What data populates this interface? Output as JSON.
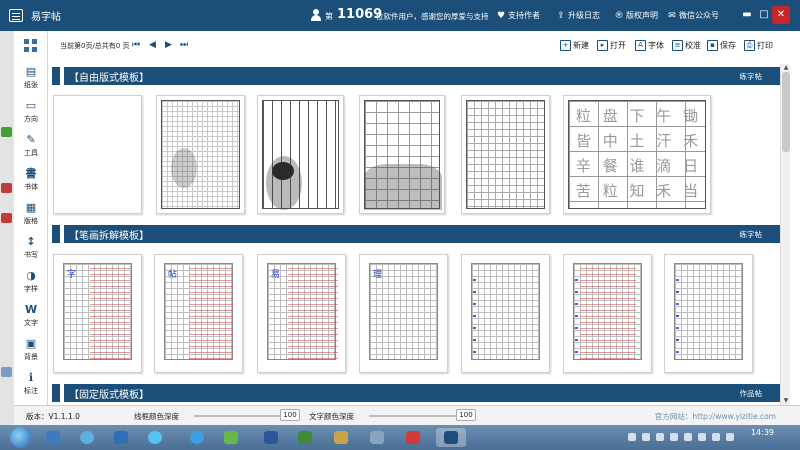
{
  "window": {
    "title": "易字帖",
    "user_prefix": "第",
    "user_count": "11069",
    "user_suffix": "位软件用户，感谢您的厚爱与支持",
    "links": [
      {
        "label": "支持作者",
        "icon": "heart-icon"
      },
      {
        "label": "升级日志",
        "icon": "upload-icon"
      },
      {
        "label": "版权声明",
        "icon": "copyright-icon"
      },
      {
        "label": "微信公众号",
        "icon": "wechat-icon"
      }
    ],
    "controls": {
      "minimize": "▬",
      "maximize": "□",
      "close": "✕"
    }
  },
  "sidebar": {
    "items": [
      {
        "label": "纸张",
        "glyph": "▤"
      },
      {
        "label": "方向",
        "glyph": "▭"
      },
      {
        "label": "工具",
        "glyph": "✎"
      },
      {
        "label": "书体",
        "glyph": "書"
      },
      {
        "label": "版格",
        "glyph": "▦"
      },
      {
        "label": "书写",
        "glyph": "↕"
      },
      {
        "label": "字样",
        "glyph": "◑"
      },
      {
        "label": "文字",
        "glyph": "W"
      },
      {
        "label": "背景",
        "glyph": "▣"
      },
      {
        "label": "标注",
        "glyph": "ℹ"
      }
    ]
  },
  "toolbar": {
    "page_info": "当前第0页/总共有0 页",
    "pager": {
      "first": "⏮",
      "prev": "◀",
      "next": "▶",
      "last": "⏭"
    },
    "actions": [
      {
        "label": "新建",
        "icon": "new-file-icon",
        "glyph": "+"
      },
      {
        "label": "打开",
        "icon": "folder-open-icon",
        "glyph": "▸"
      },
      {
        "label": "字体",
        "icon": "font-icon",
        "glyph": "A"
      },
      {
        "label": "校准",
        "icon": "calibrate-icon",
        "glyph": "≡"
      },
      {
        "label": "保存",
        "icon": "save-icon",
        "glyph": "▪"
      },
      {
        "label": "打印",
        "icon": "print-icon",
        "glyph": "⎙"
      }
    ]
  },
  "sections": [
    {
      "title": "【自由版式模板】",
      "link": "练字帖"
    },
    {
      "title": "【笔画拆解模板】",
      "link": "练字帖"
    },
    {
      "title": "【固定版式模板】",
      "link": "作品帖"
    }
  ],
  "free_templates": {
    "calligraphy_chars": [
      "粒",
      "盘",
      "下",
      "午",
      "锄",
      "皆",
      "中",
      "土",
      "汗",
      "禾",
      "辛",
      "餐",
      "谁",
      "滴",
      "日",
      "苦",
      "粒",
      "知",
      "禾",
      "当"
    ]
  },
  "stroke_templates": {
    "chars": [
      "字",
      "帖",
      "易",
      "理"
    ]
  },
  "statusbar": {
    "version": "版本：V1.1.1.0",
    "line_color_label": "线框颜色深度",
    "line_color_value": "100",
    "text_color_label": "文字颜色深度",
    "text_color_value": "100",
    "website": "官方网站：http://www.yizitie.com"
  },
  "taskbar": {
    "clock": "14:39"
  },
  "colors": {
    "title_bar": "#1b4f7a",
    "section_bar": "#1b4f7a",
    "close_button": "#c8262d",
    "accent_blue": "#2a3fd0",
    "accent_red": "#d24646"
  }
}
